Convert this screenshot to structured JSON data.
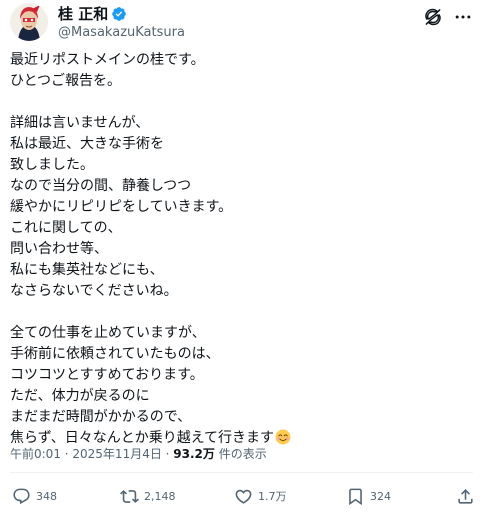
{
  "author": {
    "display_name": "桂 正和",
    "handle": "@MasakazuKatsura"
  },
  "body_lines": [
    "最近リポストメインの桂です。",
    "ひとつご報告を。",
    "",
    "詳細は言いませんが、",
    "私は最近、大きな手術を",
    "致しました。",
    "なので当分の間、静養しつつ",
    "緩やかにリピリピをしていきます。",
    "これに関しての、",
    "問い合わせ等、",
    "私にも集英社などにも、",
    "なさらないでくださいね。",
    "",
    "全ての仕事を止めていますが、",
    "手術前に依頼されていたものは、",
    "コツコツとすすめております。",
    "ただ、体力が戻るのに",
    "まだまだ時間がかかるので、",
    "焦らず、日々なんとか乗り越えて行きます"
  ],
  "meta": {
    "timestamp": "午前0:01 · 2025年11月4日",
    "separator": " · ",
    "views": "93.2万",
    "views_suffix": " 件の表示"
  },
  "actions": {
    "replies": "348",
    "reposts": "2,148",
    "likes": "1.7万",
    "bookmarks": "324"
  },
  "colors": {
    "text": "#0f1419",
    "secondary": "#536471",
    "verified": "#1d9bf0",
    "divider": "#eff3f4"
  },
  "icons": {
    "verified": "verified-badge-icon",
    "grok": "grok-icon",
    "more": "more-icon",
    "reply": "reply-icon",
    "repost": "repost-icon",
    "like": "heart-icon",
    "bookmark": "bookmark-icon",
    "share": "share-icon",
    "emoji": "smiling-face-emoji-icon"
  }
}
